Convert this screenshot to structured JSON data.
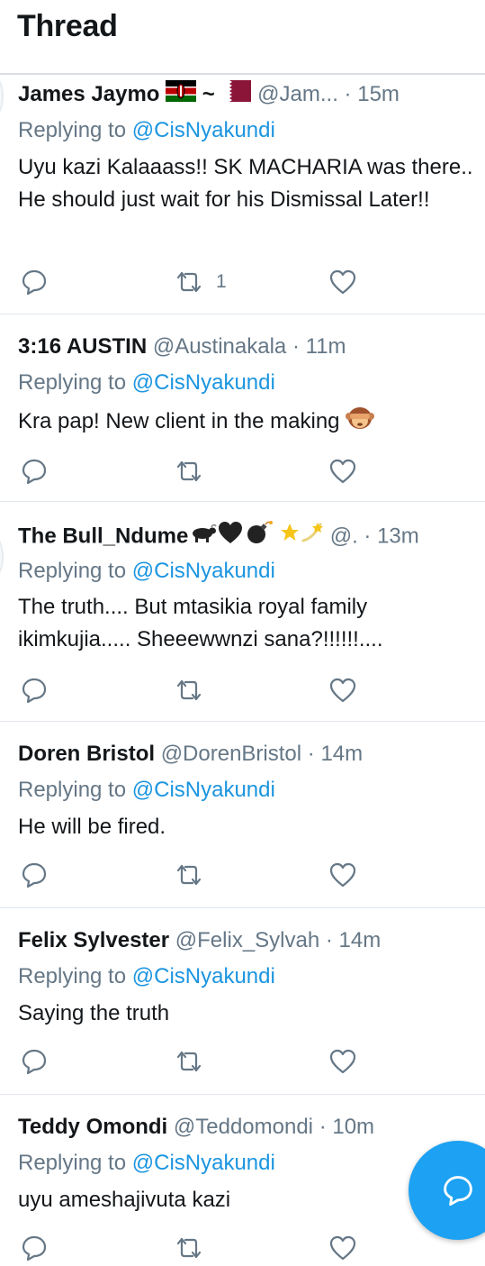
{
  "header": {
    "title": "Thread"
  },
  "tweets": [
    {
      "name": "James Jaymo",
      "name_suffix": "~",
      "handle": "@Jam...",
      "dot": "·",
      "time": "15m",
      "reply_prefix": "Replying to",
      "reply_to": "@CisNyakundi",
      "text": "Uyu kazi Kalaaass!! SK MACHARIA was there.. He should just wait for his Dismissal Later!!",
      "retweets": "1",
      "emojis": [
        "kenya-flag-icon",
        "qatar-flag-icon"
      ]
    },
    {
      "name": "3:16 AUSTIN",
      "handle": "@Austinakala",
      "dot": "·",
      "time": "11m",
      "reply_prefix": "Replying to",
      "reply_to": "@CisNyakundi",
      "text": "Kra pap! New client in the making",
      "emojis": [
        "see-no-evil-monkey-icon"
      ]
    },
    {
      "name": "The Bull_Ndume",
      "handle": "@.",
      "dot": "·",
      "time": "13m",
      "reply_prefix": "Replying to",
      "reply_to": "@CisNyakundi",
      "text": "The truth.... But mtasikia royal family ikimkujia..... Sheeewwnzi sana?!!!!!!....",
      "emojis": [
        "water-buffalo-icon",
        "black-heart-icon",
        "bomb-icon",
        "star-icon",
        "dizzy-icon"
      ]
    },
    {
      "name": "Doren Bristol",
      "handle": "@DorenBristol",
      "dot": "·",
      "time": "14m",
      "reply_prefix": "Replying to",
      "reply_to": "@CisNyakundi",
      "text": "He will be fired."
    },
    {
      "name": "Felix Sylvester",
      "handle": "@Felix_Sylvah",
      "dot": "·",
      "time": "14m",
      "reply_prefix": "Replying to",
      "reply_to": "@CisNyakundi",
      "text": "Saying the truth"
    },
    {
      "name": "Teddy Omondi",
      "handle": "@Teddomondi",
      "dot": "·",
      "time": "10m",
      "reply_prefix": "Replying to",
      "reply_to": "@CisNyakundi",
      "text": "uyu ameshajivuta kazi"
    }
  ],
  "icons": {
    "reply": "reply-icon",
    "retweet": "retweet-icon",
    "like": "heart-icon",
    "compose": "compose-reply-icon"
  },
  "colors": {
    "link": "#1b95e0",
    "secondary": "#657786",
    "fab": "#1da1f2",
    "divider": "#e1e8ed"
  }
}
